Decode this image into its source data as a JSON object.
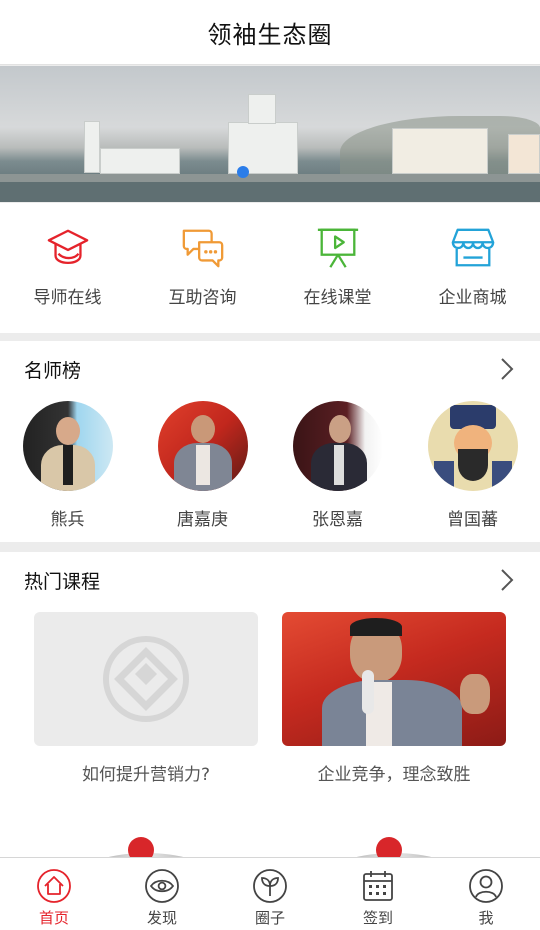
{
  "header": {
    "title": "领袖生态圈"
  },
  "colors": {
    "brand": "#e5232b",
    "accent_orange": "#f09a36",
    "accent_green": "#4bb539",
    "accent_blue": "#23a3d8",
    "pager_dot": "#2b7de9"
  },
  "quick_links": [
    {
      "label": "导师在线",
      "icon": "mortarboard-icon"
    },
    {
      "label": "互助咨询",
      "icon": "chat-bubbles-icon"
    },
    {
      "label": "在线课堂",
      "icon": "presentation-screen-icon"
    },
    {
      "label": "企业商城",
      "icon": "storefront-icon"
    }
  ],
  "teachers_section": {
    "title": "名师榜",
    "items": [
      {
        "name": "熊兵"
      },
      {
        "name": "唐嘉庚"
      },
      {
        "name": "张恩嘉"
      },
      {
        "name": "曾国蕃"
      }
    ]
  },
  "courses_section": {
    "title": "热门课程",
    "items": [
      {
        "title": "如何提升营销力?"
      },
      {
        "title": "企业竞争，理念致胜"
      }
    ]
  },
  "tabbar": {
    "tabs": [
      {
        "label": "首页",
        "icon": "home-icon",
        "active": true
      },
      {
        "label": "发现",
        "icon": "eye-icon",
        "active": false
      },
      {
        "label": "圈子",
        "icon": "sprout-icon",
        "active": false
      },
      {
        "label": "签到",
        "icon": "calendar-icon",
        "active": false
      },
      {
        "label": "我",
        "icon": "user-icon",
        "active": false
      }
    ]
  }
}
